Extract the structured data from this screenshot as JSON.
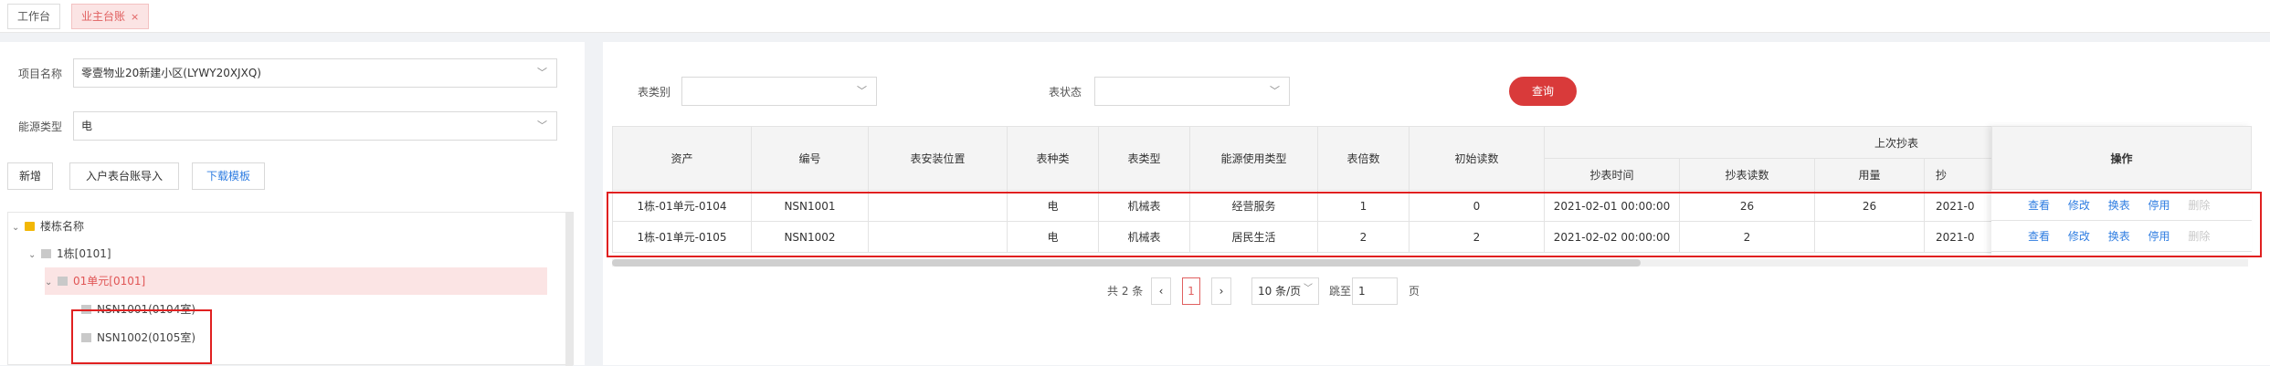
{
  "tabs": [
    {
      "label": "工作台"
    },
    {
      "label": "业主台账",
      "close": "×"
    }
  ],
  "filters": {
    "project_label": "项目名称",
    "project_value": "零壹物业20新建小区(LYWY20XJXQ)",
    "energy_label": "能源类型",
    "energy_value": "电",
    "meter_type_label": "表类别",
    "meter_type_value": "",
    "meter_status_label": "表状态",
    "meter_status_value": ""
  },
  "buttons": {
    "add": "新增",
    "import": "入户表台账导入",
    "download": "下载模板",
    "query": "查询"
  },
  "tree": {
    "root": "楼栋名称",
    "building": "1栋[0101]",
    "unit": "01单元[0101]",
    "rooms": [
      "NSN1001(0104室)",
      "NSN1002(0105室)"
    ]
  },
  "table": {
    "headers": {
      "asset": "资产",
      "number": "编号",
      "location": "表安装位置",
      "kind": "表种类",
      "type": "表类型",
      "usage": "能源使用类型",
      "multiplier": "表倍数",
      "initial": "初始读数",
      "last_group": "上次抄表",
      "last_time": "抄表时间",
      "last_reading": "抄表读数",
      "last_usage": "用量",
      "next_cut": "抄",
      "actions": "操作"
    },
    "rows": [
      {
        "asset": "1栋-01单元-0104",
        "number": "NSN1001",
        "location": "",
        "kind": "电",
        "type": "机械表",
        "usage": "经营服务",
        "multiplier": "1",
        "initial": "0",
        "last_time": "2021-02-01 00:00:00",
        "last_reading": "26",
        "last_usage": "26",
        "next_cut": "2021-0"
      },
      {
        "asset": "1栋-01单元-0105",
        "number": "NSN1002",
        "location": "",
        "kind": "电",
        "type": "机械表",
        "usage": "居民生活",
        "multiplier": "2",
        "initial": "2",
        "last_time": "2021-02-02 00:00:00",
        "last_reading": "2",
        "last_usage": "",
        "next_cut": "2021-0"
      }
    ],
    "row_actions": [
      "查看",
      "修改",
      "换表",
      "停用",
      "删除"
    ]
  },
  "pagination": {
    "total": "共 2 条",
    "prev": "‹",
    "current": "1",
    "next": "›",
    "page_size": "10 条/页",
    "goto_label": "跳至",
    "goto_value": "1",
    "page_suffix": "页"
  }
}
